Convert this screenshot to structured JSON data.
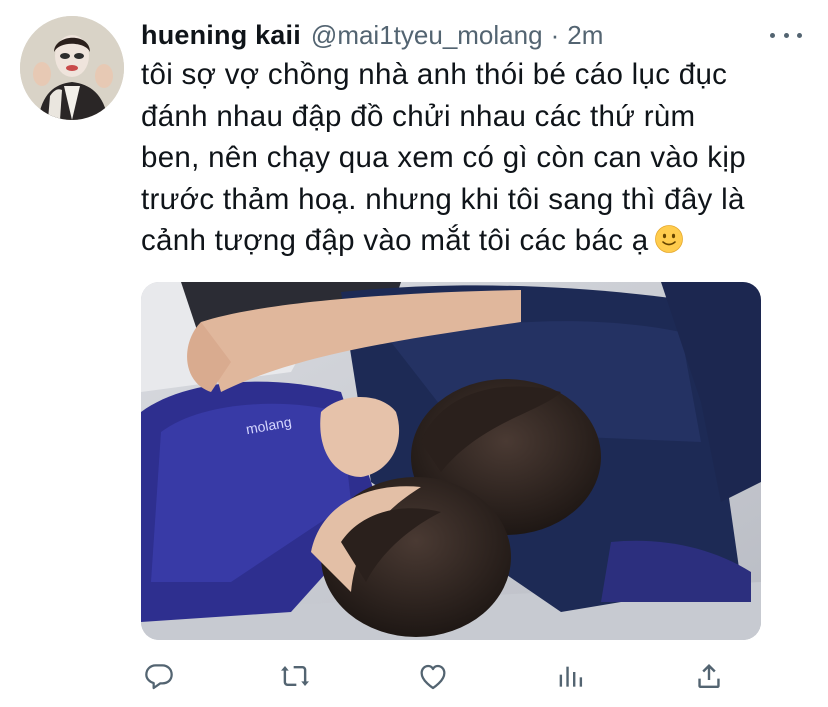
{
  "tweet": {
    "author_name": "huening kaii",
    "handle": "@mai1tyeu_molang",
    "separator": "·",
    "time": "2m",
    "text_lines": [
      "tôi sợ vợ chồng nhà anh thói bé cáo lục đục",
      "đánh nhau đập đồ chửi nhau các thứ rùm",
      "ben, nên chạy qua xem có gì còn can vào kịp",
      "trước thảm hoạ. nhưng khi tôi sang thì đây là",
      "cảnh tượng đập vào mắt tôi các bác ạ"
    ],
    "emoji": "slightly-smiling-face",
    "shirt_print": "molang"
  },
  "actions": [
    "reply-icon",
    "retweet-icon",
    "like-icon",
    "analytics-icon",
    "share-icon"
  ],
  "colors": {
    "text": "#0f1419",
    "muted": "#536471",
    "icon": "#536471"
  }
}
